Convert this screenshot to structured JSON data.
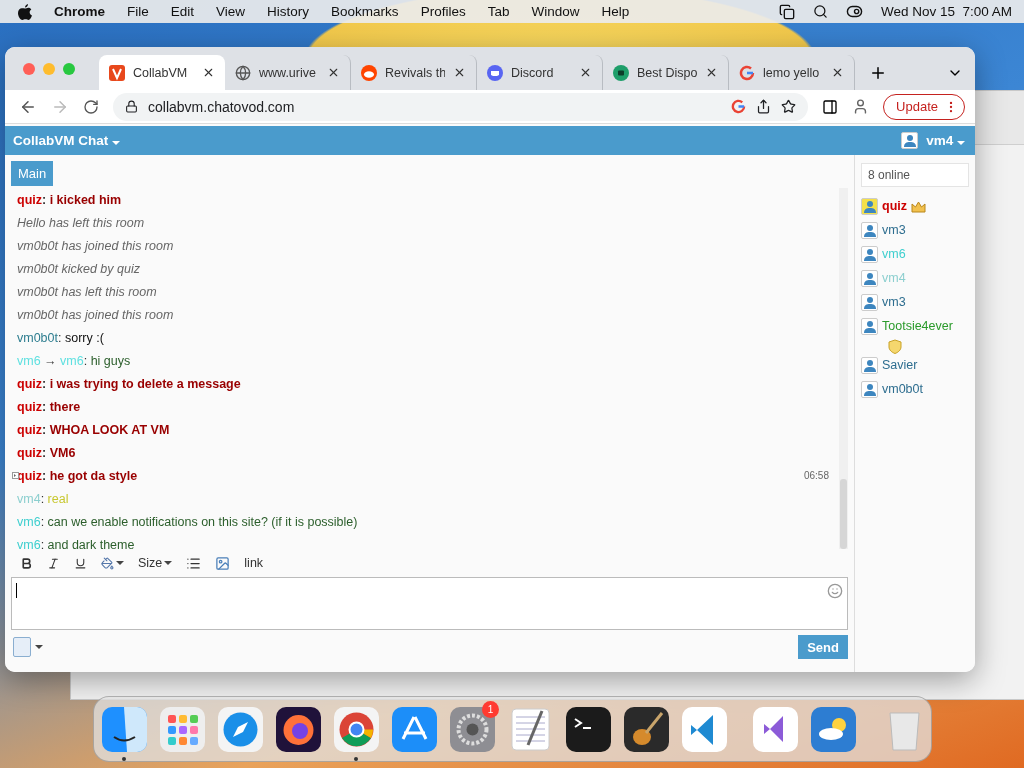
{
  "menubar": {
    "app": "Chrome",
    "items": [
      "File",
      "Edit",
      "View",
      "History",
      "Bookmarks",
      "Profiles",
      "Tab",
      "Window",
      "Help"
    ],
    "clock": "Wed Nov 15  7:00 AM"
  },
  "browser": {
    "tabs": [
      {
        "title": "CollabVM",
        "kind": "collabvm",
        "selected": true
      },
      {
        "title": "www.urive",
        "kind": "globe",
        "selected": false
      },
      {
        "title": "Revivals th",
        "kind": "reddit",
        "selected": false
      },
      {
        "title": "Discord",
        "kind": "discord",
        "selected": false
      },
      {
        "title": "Best Dispo",
        "kind": "chat",
        "selected": false
      },
      {
        "title": "lemo yello",
        "kind": "google",
        "selected": false
      }
    ],
    "url": "collabvm.chatovod.com",
    "update_label": "Update"
  },
  "chat": {
    "title": "CollabVM Chat",
    "current_user": "vm4",
    "room_tabs": [
      {
        "label": "Main",
        "selected": true
      }
    ],
    "online_count": "8 online",
    "messages": [
      {
        "kind": "chat",
        "author": {
          "name": "quiz",
          "color": "#cc0000"
        },
        "separator": ": ",
        "content": {
          "text": "i kicked him",
          "color": "#990000"
        },
        "bold": true
      },
      {
        "kind": "system",
        "text": "Hello has left this room"
      },
      {
        "kind": "system",
        "text": "vm0b0t has joined this room"
      },
      {
        "kind": "system",
        "text": "vm0b0t kicked by quiz"
      },
      {
        "kind": "system",
        "text": "vm0b0t has left this room"
      },
      {
        "kind": "system",
        "text": "vm0b0t has joined this room"
      },
      {
        "kind": "chat",
        "author": {
          "name": "vm0b0t",
          "color": "#2d7d8f"
        },
        "separator": ": ",
        "content": {
          "text": "sorry :(",
          "color": "#111111"
        },
        "bold": false
      },
      {
        "kind": "private",
        "author": {
          "name": "vm6",
          "color": "#5ee0e0"
        },
        "arrow": " → ",
        "recipient": {
          "name": "vm6",
          "color": "#5ee0e0"
        },
        "separator": ": ",
        "content": {
          "text": "hi guys",
          "color": "#2b5e2b"
        },
        "bold": false
      },
      {
        "kind": "chat",
        "author": {
          "name": "quiz",
          "color": "#cc0000"
        },
        "separator": ": ",
        "content": {
          "text": "i was trying to delete a message",
          "color": "#990000"
        },
        "bold": true
      },
      {
        "kind": "chat",
        "author": {
          "name": "quiz",
          "color": "#cc0000"
        },
        "separator": ": ",
        "content": {
          "text": "there",
          "color": "#990000"
        },
        "bold": true
      },
      {
        "kind": "chat",
        "author": {
          "name": "quiz",
          "color": "#cc0000"
        },
        "separator": ": ",
        "content": {
          "text": "WHOA LOOK AT VM",
          "color": "#990000"
        },
        "bold": true
      },
      {
        "kind": "chat",
        "author": {
          "name": "quiz",
          "color": "#cc0000"
        },
        "separator": ": ",
        "content": {
          "text": "VM6",
          "color": "#990000"
        },
        "bold": true
      },
      {
        "kind": "chat",
        "author": {
          "name": "quiz",
          "color": "#cc0000"
        },
        "separator": ": ",
        "content": {
          "text": "he got da style",
          "color": "#990000"
        },
        "bold": true,
        "time": "06:58"
      },
      {
        "kind": "chat",
        "author": {
          "name": "vm4",
          "color": "#8ccfcf"
        },
        "separator": ": ",
        "content": {
          "text": "real",
          "color": "#c8c830"
        },
        "bold": false
      },
      {
        "kind": "chat",
        "author": {
          "name": "vm6",
          "color": "#3fcfcf"
        },
        "separator": ": ",
        "content": {
          "text": "can we enable notifications on this site? (if it is possible)",
          "color": "#2b5e2b"
        },
        "bold": false
      },
      {
        "kind": "chat",
        "author": {
          "name": "vm6",
          "color": "#3fcfcf"
        },
        "separator": ": ",
        "content": {
          "text": "and dark theme",
          "color": "#2b5e2b"
        },
        "bold": false
      }
    ],
    "toolbar": {
      "size_label": "Size",
      "link_label": "link"
    },
    "send_label": "Send",
    "users": [
      {
        "kind": "owner",
        "name": "quiz",
        "color": "#cc0000",
        "bold": true,
        "highlighted": true
      },
      {
        "kind": "user",
        "name": "vm3",
        "color": "#2d6d8f",
        "bold": false,
        "highlighted": false
      },
      {
        "kind": "user",
        "name": "vm6",
        "color": "#3fcfcf",
        "bold": false,
        "highlighted": false
      },
      {
        "kind": "user",
        "name": "vm4",
        "color": "#8ccfcf",
        "bold": false,
        "highlighted": false
      },
      {
        "kind": "user",
        "name": "vm3",
        "color": "#2d6d8f",
        "bold": false,
        "highlighted": false
      },
      {
        "kind": "moderator",
        "name": "Tootsie4ever",
        "color": "#2a9a2a",
        "bold": false,
        "highlighted": false
      },
      {
        "kind": "user",
        "name": "Savier",
        "color": "#2d6d8f",
        "bold": false,
        "highlighted": false
      },
      {
        "kind": "user",
        "name": "vm0b0t",
        "color": "#2d6d8f",
        "bold": false,
        "highlighted": false
      }
    ]
  },
  "dock": [
    {
      "kind": "finder",
      "running": true
    },
    {
      "kind": "launchpad",
      "running": false
    },
    {
      "kind": "safari",
      "running": false
    },
    {
      "kind": "firefox",
      "running": false
    },
    {
      "kind": "chrome",
      "running": true
    },
    {
      "kind": "appstore",
      "running": false
    },
    {
      "kind": "settings",
      "running": false,
      "badge": "1"
    },
    {
      "kind": "textedit",
      "running": false
    },
    {
      "kind": "terminal",
      "running": false
    },
    {
      "kind": "guitar",
      "running": false
    },
    {
      "kind": "vscode",
      "running": false
    },
    {
      "kind": "separator"
    },
    {
      "kind": "visualstudio",
      "running": false
    },
    {
      "kind": "weather",
      "running": false
    },
    {
      "kind": "separator"
    },
    {
      "kind": "trash",
      "running": false
    }
  ]
}
